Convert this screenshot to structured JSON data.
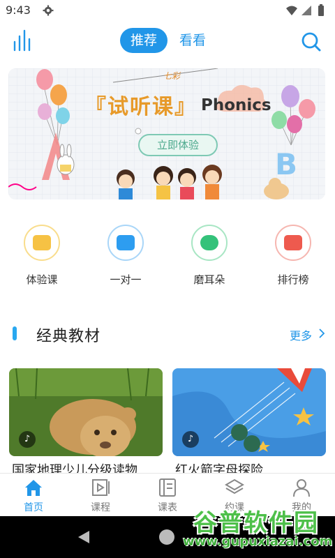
{
  "status_bar": {
    "time": "9:43",
    "icons": [
      "gear-icon",
      "wifi-icon",
      "signal-icon",
      "battery-icon"
    ]
  },
  "top_nav": {
    "tabs": [
      {
        "label": "推荐",
        "active": true
      },
      {
        "label": "看看",
        "active": false
      }
    ],
    "icons": [
      "bar-chart-icon",
      "search-icon"
    ]
  },
  "banner": {
    "title": "『试听课』",
    "subtitle": "Phonics",
    "cta": "立即体验",
    "brand_text": "七彩"
  },
  "quick_entries": [
    {
      "label": "体验课",
      "color": "#f6c244",
      "icon": "book-icon"
    },
    {
      "label": "一对一",
      "color": "#2d9df0",
      "icon": "chat-icon"
    },
    {
      "label": "磨耳朵",
      "color": "#34c27a",
      "icon": "abc-bubble-icon"
    },
    {
      "label": "排行榜",
      "color": "#ee5a4e",
      "icon": "bookmark-star-icon"
    }
  ],
  "section": {
    "title": "经典教材",
    "more": "更多"
  },
  "cards": [
    {
      "title": "国家地理少儿分级读物",
      "badge": "♪"
    },
    {
      "title": "红火箭字母探险",
      "badge": "♪"
    }
  ],
  "bottom_tabs": [
    {
      "label": "首页",
      "active": true,
      "icon": "home-icon"
    },
    {
      "label": "课程",
      "active": false,
      "icon": "play-box-icon"
    },
    {
      "label": "课表",
      "active": false,
      "icon": "schedule-icon"
    },
    {
      "label": "约课",
      "active": false,
      "icon": "layers-icon"
    },
    {
      "label": "我的",
      "active": false,
      "icon": "user-icon"
    }
  ],
  "watermark": {
    "main": "谷普软件园",
    "sub": "www.gupuxiazai.com"
  },
  "colors": {
    "accent": "#2196e8",
    "section_bar": "#29a8f0"
  }
}
